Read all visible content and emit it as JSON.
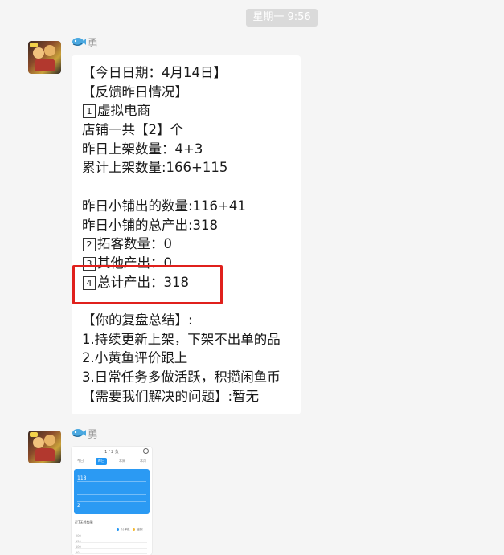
{
  "timestamp": "星期一 9:56",
  "sender_name": "勇",
  "message": {
    "lines": [
      "【今日日期：4月14日】",
      "【反馈昨日情况】",
      "1|虚拟电商",
      "店铺一共【2】个",
      "昨日上架数量：4+3",
      "累计上架数量:166+115",
      "",
      "昨日小铺出的数量:116+41",
      "昨日小铺的总产出:318",
      "2|拓客数量：0",
      "3|其他产出：0",
      "4|总计产出：318",
      "",
      "【你的复盘总结】:",
      "1.持续更新上架，下架不出单的品",
      "2.小黄鱼评价跟上",
      "3.日常任务多做活跃，积攒闲鱼币",
      "【需要我们解决的问题】:暂无"
    ]
  },
  "highlight_color": "#e0201c",
  "bubble_color": "#ffffff",
  "background_color": "#f5f5f5",
  "thumbnail": {
    "title": "1 / 2 负",
    "tabs": [
      "今日",
      "昨日",
      "本周",
      "本月"
    ],
    "active_tab": 1,
    "card_value_1": "118",
    "card_value_2": "2",
    "section_title": "近7天趋势图",
    "legend": [
      "订单数",
      "金额"
    ],
    "accent": "#2196f3",
    "axis_values": [
      "200",
      "150",
      "100",
      "50"
    ]
  }
}
